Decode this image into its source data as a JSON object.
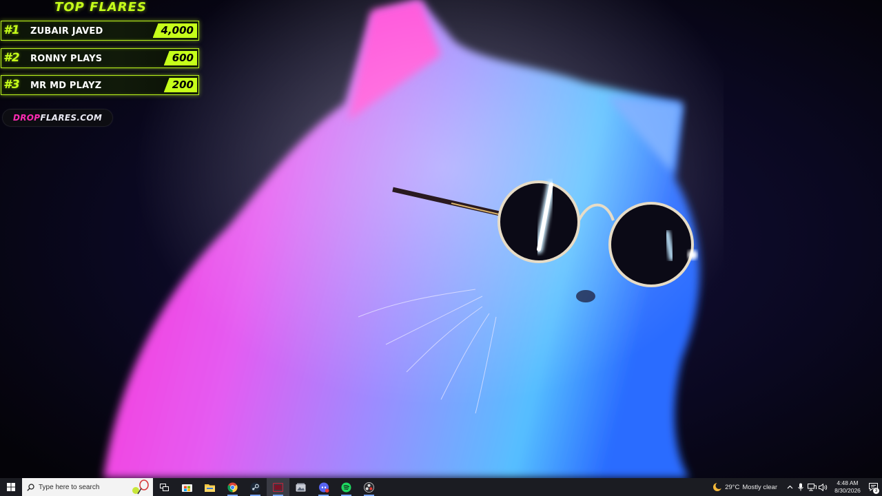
{
  "overlay": {
    "title": "TOP FLARES",
    "leaderboard": [
      {
        "rank": "#1",
        "name": "ZUBAIR JAVED",
        "amount": "4,000"
      },
      {
        "rank": "#2",
        "name": "RONNY PLAYS",
        "amount": "600"
      },
      {
        "rank": "#3",
        "name": "MR MD PLAYZ",
        "amount": "200"
      }
    ],
    "site_part1": "DROP",
    "site_part2": "FLARES.COM",
    "accent_color": "#c6ff1a",
    "brand_pink": "#ff2bb3"
  },
  "wallpaper": {
    "subject": "neon-cat-with-sunglasses"
  },
  "taskbar": {
    "search_placeholder": "Type here to search",
    "pinned_icons": [
      "task-view-icon",
      "microsoft-store-icon",
      "file-explorer-icon",
      "chrome-icon",
      "steam-icon",
      "app-icon",
      "gallery-icon",
      "discord-icon",
      "spotify-icon",
      "obs-icon"
    ],
    "weather": {
      "temp": "29°C",
      "condition": "Mostly clear"
    },
    "clock": {
      "time": "4:48 AM",
      "date": "8/30/2026"
    },
    "notification_count": "3",
    "background": "#1b1c22"
  }
}
